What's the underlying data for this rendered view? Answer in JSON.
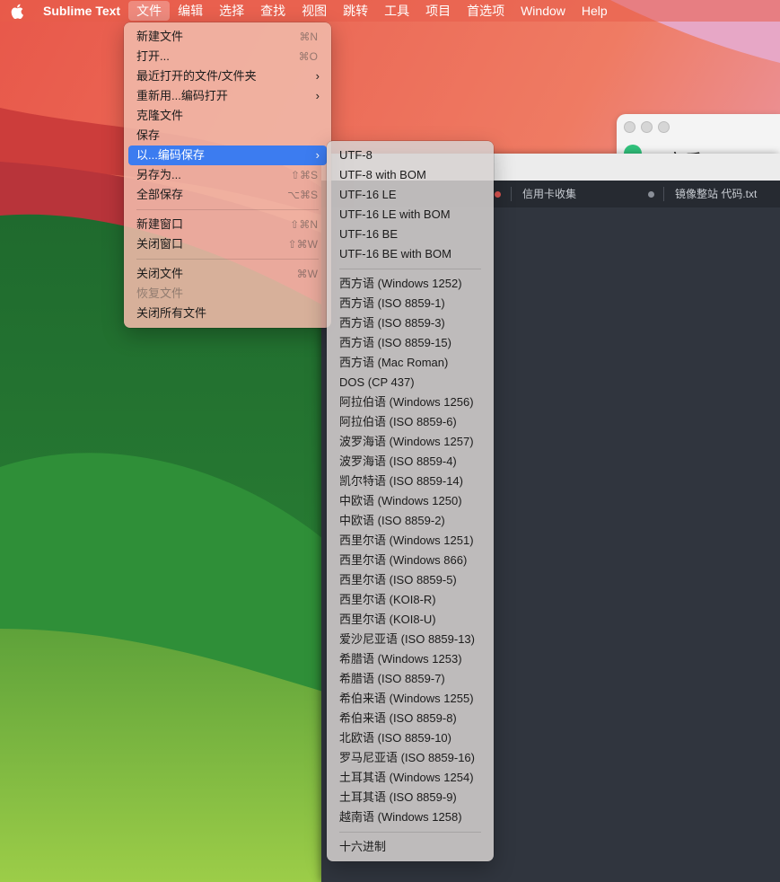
{
  "menubar": {
    "app_name": "Sublime Text",
    "items": [
      "文件",
      "编辑",
      "选择",
      "查找",
      "视图",
      "跳转",
      "工具",
      "项目",
      "首选项",
      "Window",
      "Help"
    ]
  },
  "qq_window": {
    "title": "QQ音乐"
  },
  "sublime": {
    "tabs": [
      {
        "label": "信用卡收集",
        "dirty": true
      },
      {
        "label": "镜像整站 代码.txt",
        "dirty": true
      }
    ]
  },
  "file_menu": {
    "items": [
      {
        "label": "新建文件",
        "shortcut": "⌘N"
      },
      {
        "label": "打开...",
        "shortcut": "⌘O"
      },
      {
        "label": "最近打开的文件/文件夹",
        "submenu": true
      },
      {
        "label": "重新用...编码打开",
        "submenu": true
      },
      {
        "label": "克隆文件"
      },
      {
        "label": "保存"
      },
      {
        "label": "以...编码保存",
        "submenu": true,
        "selected": true
      },
      {
        "label": "另存为...",
        "shortcut": "⇧⌘S"
      },
      {
        "label": "全部保存",
        "shortcut": "⌥⌘S"
      },
      {
        "separator": true
      },
      {
        "label": "新建窗口",
        "shortcut": "⇧⌘N"
      },
      {
        "label": "关闭窗口",
        "shortcut": "⇧⌘W"
      },
      {
        "separator": true
      },
      {
        "label": "关闭文件",
        "shortcut": "⌘W"
      },
      {
        "label": "恢复文件",
        "disabled": true
      },
      {
        "label": "关闭所有文件"
      }
    ]
  },
  "encoding_menu": {
    "items": [
      "UTF-8",
      "UTF-8 with BOM",
      "UTF-16 LE",
      "UTF-16 LE with BOM",
      "UTF-16 BE",
      "UTF-16 BE with BOM",
      "---",
      "西方语 (Windows 1252)",
      "西方语 (ISO 8859-1)",
      "西方语 (ISO 8859-3)",
      "西方语 (ISO 8859-15)",
      "西方语 (Mac Roman)",
      "DOS (CP 437)",
      "阿拉伯语 (Windows 1256)",
      "阿拉伯语 (ISO 8859-6)",
      "波罗海语 (Windows 1257)",
      "波罗海语 (ISO 8859-4)",
      "凯尔特语 (ISO 8859-14)",
      "中欧语 (Windows 1250)",
      "中欧语 (ISO 8859-2)",
      "西里尔语 (Windows 1251)",
      "西里尔语 (Windows 866)",
      "西里尔语 (ISO 8859-5)",
      "西里尔语 (KOI8-R)",
      "西里尔语 (KOI8-U)",
      "爱沙尼亚语 (ISO 8859-13)",
      "希腊语 (Windows 1253)",
      "希腊语 (ISO 8859-7)",
      "希伯来语 (Windows 1255)",
      "希伯来语 (ISO 8859-8)",
      "北欧语 (ISO 8859-10)",
      "罗马尼亚语 (ISO 8859-16)",
      "土耳其语 (Windows 1254)",
      "土耳其语 (ISO 8859-9)",
      "越南语 (Windows 1258)",
      "---",
      "十六进制"
    ]
  },
  "colors": {
    "selection": "#3c7cf0",
    "tab_dirty_dot": "#d9534f"
  }
}
